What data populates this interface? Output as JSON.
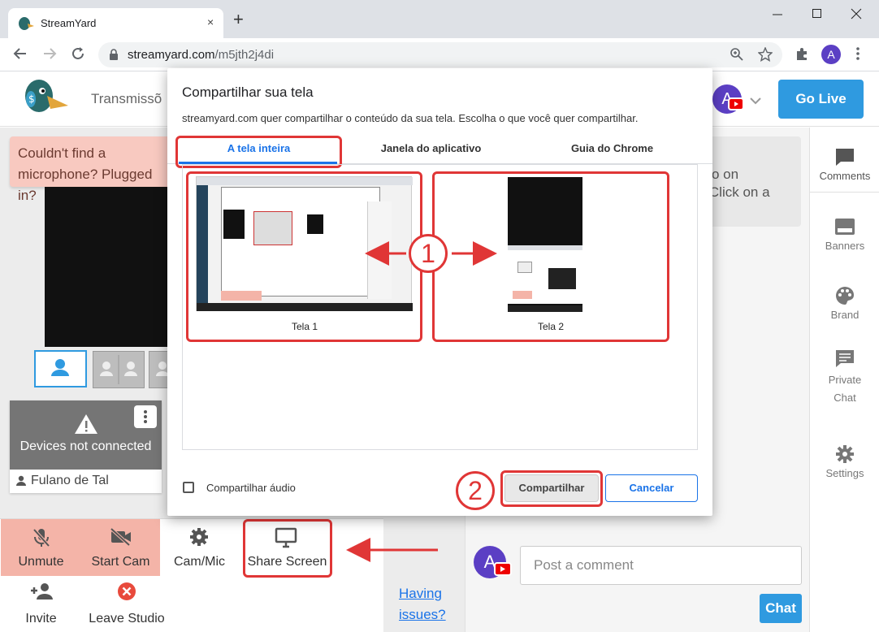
{
  "browser": {
    "tab_title": "StreamYard",
    "tab_close": "×",
    "new_tab": "+",
    "url_host": "streamyard.com",
    "url_path": "/m5jth2j4di",
    "profile_letter": "A"
  },
  "header": {
    "nav_label": "Transmissõ",
    "go_live": "Go Live",
    "avatar_letter": "A"
  },
  "warning": "Couldn't find a microphone? Plugged in?",
  "device_card": {
    "status": "Devices not connected",
    "name": "Fulano de Tal"
  },
  "controls": {
    "unmute": "Unmute",
    "start_cam": "Start Cam",
    "cam_mic": "Cam/Mic",
    "share_screen": "Share Screen",
    "invite": "Invite",
    "leave": "Leave Studio",
    "issues_1": "Having",
    "issues_2": "issues?"
  },
  "info_card": {
    "line1": "o on",
    "line2": "e. Click on a"
  },
  "comment": {
    "placeholder": "Post a comment",
    "chat": "Chat",
    "avatar_letter": "A"
  },
  "sidebar": {
    "items": [
      {
        "label": "Comments",
        "icon": "comment-icon"
      },
      {
        "label": "Banners",
        "icon": "banner-icon"
      },
      {
        "label": "Brand",
        "icon": "palette-icon"
      },
      {
        "label": "Private Chat",
        "icon": "private-chat-icon"
      },
      {
        "label": "Settings",
        "icon": "gear-icon"
      }
    ]
  },
  "dialog": {
    "title": "Compartilhar sua tela",
    "subtitle": "streamyard.com quer compartilhar o conteúdo da sua tela. Escolha o que você quer compartilhar.",
    "tabs": [
      "A tela inteira",
      "Janela do aplicativo",
      "Guia do Chrome"
    ],
    "screens": [
      "Tela 1",
      "Tela 2"
    ],
    "audio_label": "Compartilhar áudio",
    "share": "Compartilhar",
    "cancel": "Cancelar"
  },
  "annotations": {
    "step1": "1",
    "step2": "2"
  },
  "colors": {
    "accent": "#2f9ae0",
    "annotation_red": "#e03636",
    "chrome_blue": "#1a73e8"
  }
}
